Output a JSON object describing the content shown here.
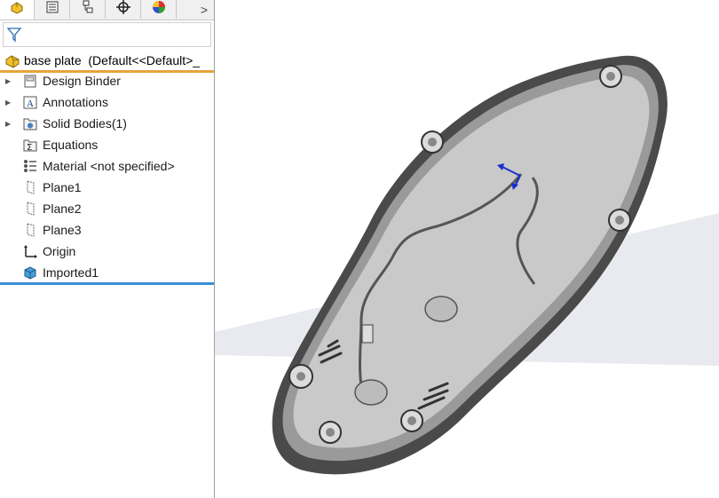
{
  "tabs": [
    {
      "icon": "feature-manager-icon",
      "active": true
    },
    {
      "icon": "property-manager-icon",
      "active": false
    },
    {
      "icon": "configuration-manager-icon",
      "active": false
    },
    {
      "icon": "dimxpert-icon",
      "active": false
    },
    {
      "icon": "display-manager-icon",
      "active": false
    }
  ],
  "more_tabs_glyph": ">",
  "filter": {
    "icon": "filter-icon",
    "value": ""
  },
  "root": {
    "label": "base plate  (Default<<Default>_",
    "icon": "part-icon"
  },
  "tree": [
    {
      "label": "Design Binder",
      "icon": "design-binder-icon",
      "expandable": true
    },
    {
      "label": "Annotations",
      "icon": "annotations-icon",
      "expandable": true
    },
    {
      "label": "Solid Bodies(1)",
      "icon": "solid-bodies-icon",
      "expandable": true
    },
    {
      "label": "Equations",
      "icon": "equations-icon",
      "expandable": false
    },
    {
      "label": "Material <not specified>",
      "icon": "material-icon",
      "expandable": false
    },
    {
      "label": "Plane1",
      "icon": "plane-icon",
      "expandable": false
    },
    {
      "label": "Plane2",
      "icon": "plane-icon",
      "expandable": false
    },
    {
      "label": "Plane3",
      "icon": "plane-icon",
      "expandable": false
    },
    {
      "label": "Origin",
      "icon": "origin-icon",
      "expandable": false
    },
    {
      "label": "Imported1",
      "icon": "imported-feature-icon",
      "expandable": false
    }
  ],
  "colors": {
    "rollback_bar": "#3a8fd6",
    "root_underline": "#e8a33a",
    "part_body": "#c9c9c9",
    "part_rim": "#4a4a4a",
    "floor": "#e8eaef"
  }
}
